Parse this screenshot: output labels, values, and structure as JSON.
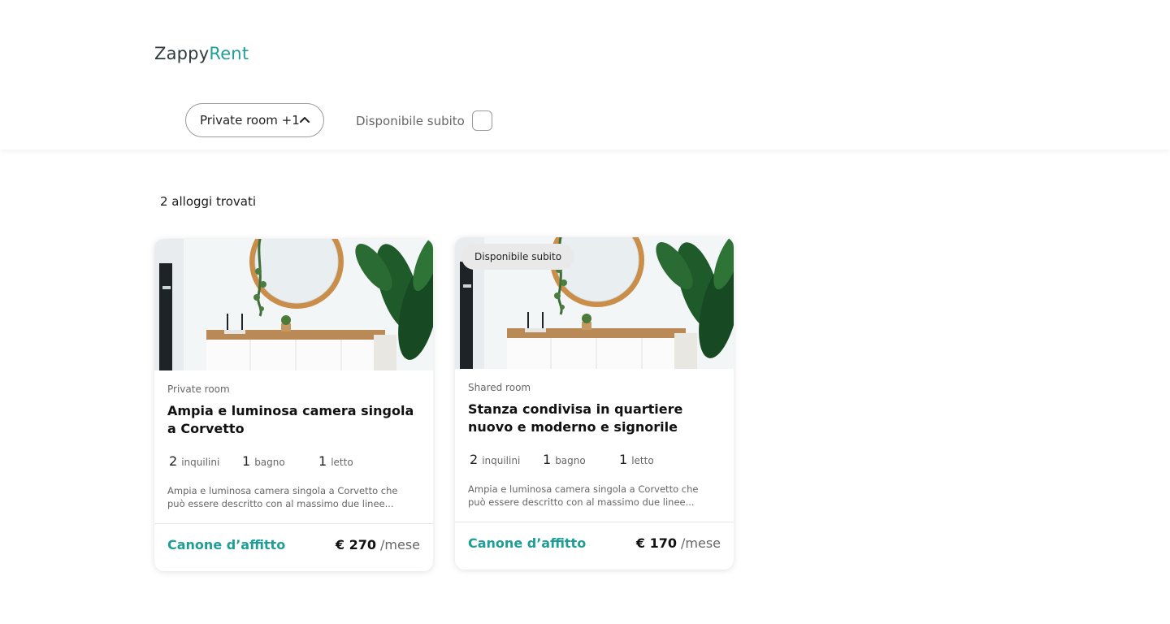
{
  "header": {
    "logo_dark": "Zappy",
    "logo_accent": "Rent",
    "accent_color": "#1f9e97"
  },
  "filters": {
    "room_type_label": "Private room +1",
    "room_type_icon": "chevron-up-icon",
    "available_now_label": "Disponibile subito",
    "available_now_checked": false
  },
  "results": {
    "count_label": "2 alloggi trovati"
  },
  "listings": [
    {
      "badge": "",
      "type": "Private room",
      "title": "Ampia e luminosa camera singola a Corvetto",
      "tenants_num": "2",
      "tenants_label": "inquilini",
      "bath_num": "1",
      "bath_label": "bagno",
      "bed_num": "1",
      "bed_label": "letto",
      "description": "Ampia e luminosa camera singola a Corvetto che può essere descritto con al massimo due linee...",
      "rent_label": "Canone d’affitto",
      "price": "€ 270",
      "price_period": "/mese"
    },
    {
      "badge": "Disponibile subito",
      "type": "Shared room",
      "title": "Stanza condivisa in quartiere nuovo e moderno e signorile",
      "tenants_num": "2",
      "tenants_label": "inquilini",
      "bath_num": "1",
      "bath_label": "bagno",
      "bed_num": "1",
      "bed_label": "letto",
      "description": "Ampia e luminosa camera singola a Corvetto che può essere descritto con al massimo due linee...",
      "rent_label": "Canone d’affitto",
      "price": "€ 170",
      "price_period": "/mese"
    }
  ]
}
